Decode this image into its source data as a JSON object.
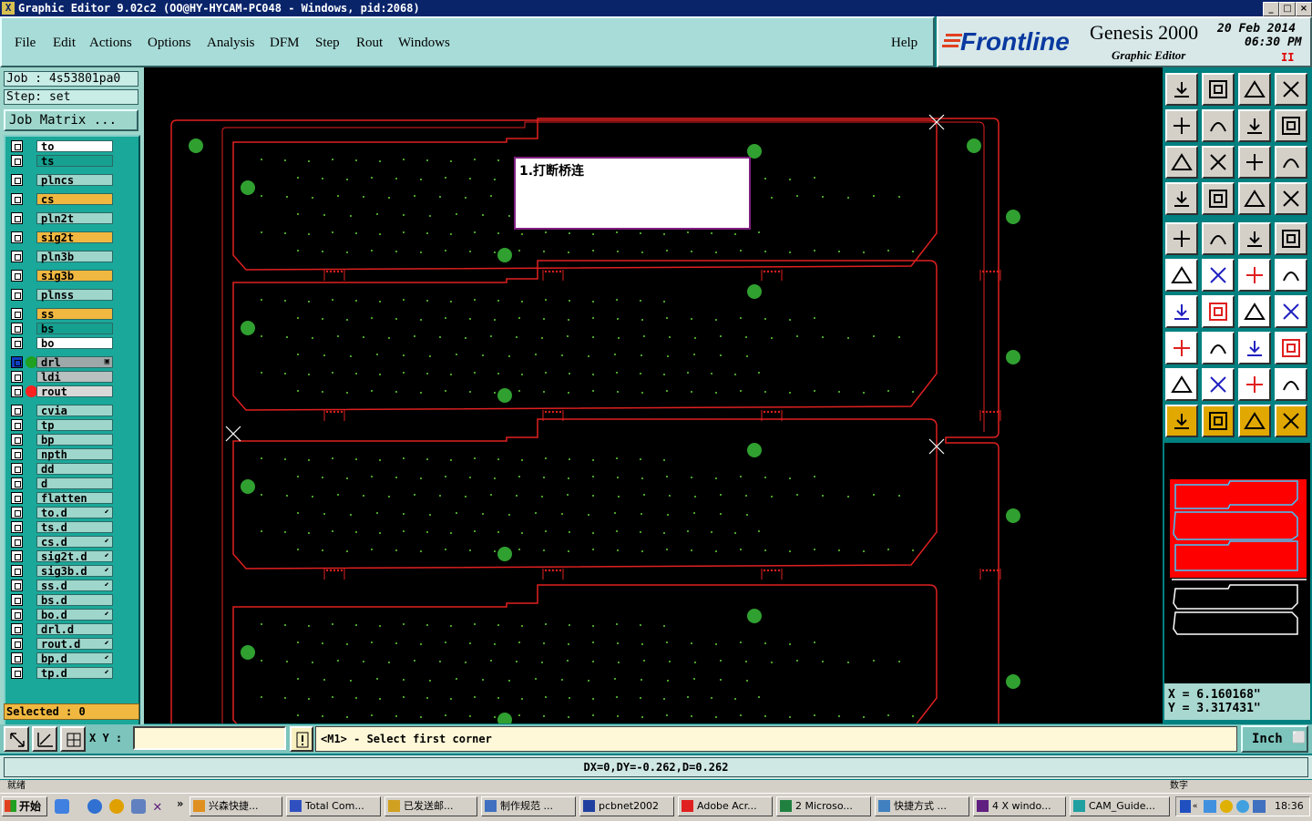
{
  "window": {
    "title": "Graphic Editor 9.02c2  (OO@HY-HYCAM-PC048 - Windows, pid:2068)",
    "icon": "X"
  },
  "menu": [
    "File",
    "Edit",
    "Actions",
    "Options",
    "Analysis",
    "DFM",
    "Step",
    "Rout",
    "Windows"
  ],
  "help": "Help",
  "brand": {
    "logo": "Frontline",
    "product": "Genesis 2000",
    "subtitle": "Graphic Editor",
    "date": "20 Feb 2014",
    "time": "06:30 PM",
    "pause": "II"
  },
  "job": {
    "label": "Job : 4s53801pa0",
    "step": "Step:  set",
    "matrix_button": "Job Matrix ..."
  },
  "layers": [
    {
      "name": "to",
      "bg": "#ffffff"
    },
    {
      "name": "ts",
      "bg": "#16a090"
    },
    {
      "name": "plncs",
      "bg": "#9ed6cc"
    },
    {
      "name": "cs",
      "bg": "#f0b840"
    },
    {
      "name": "pln2t",
      "bg": "#9ed6cc"
    },
    {
      "name": "sig2t",
      "bg": "#f0b840"
    },
    {
      "name": "pln3b",
      "bg": "#9ed6cc"
    },
    {
      "name": "sig3b",
      "bg": "#f0b840"
    },
    {
      "name": "plnss",
      "bg": "#9ed6cc"
    },
    {
      "name": "ss",
      "bg": "#f0b840"
    },
    {
      "name": "bs",
      "bg": "#16a090"
    },
    {
      "name": "bo",
      "bg": "#ffffff"
    },
    {
      "name": "drl",
      "bg": "#9ea8a8",
      "dot": "#20a020",
      "mark": "▣",
      "selected": true
    },
    {
      "name": "ldi",
      "bg": "#b8c0c0"
    },
    {
      "name": "rout",
      "bg": "#d8d8d8",
      "dot": "#ff2020"
    },
    {
      "name": "cvia",
      "bg": "#9ed6cc"
    },
    {
      "name": "tp",
      "bg": "#9ed6cc"
    },
    {
      "name": "bp",
      "bg": "#9ed6cc"
    },
    {
      "name": "npth",
      "bg": "#9ed6cc"
    },
    {
      "name": "dd",
      "bg": "#9ed6cc"
    },
    {
      "name": "d",
      "bg": "#9ed6cc"
    },
    {
      "name": "flatten",
      "bg": "#9ed6cc"
    },
    {
      "name": "to.d",
      "bg": "#9ed6cc",
      "mark": "⬋"
    },
    {
      "name": "ts.d",
      "bg": "#9ed6cc"
    },
    {
      "name": "cs.d",
      "bg": "#9ed6cc",
      "mark": "⬋"
    },
    {
      "name": "sig2t.d",
      "bg": "#9ed6cc",
      "mark": "⬋"
    },
    {
      "name": "sig3b.d",
      "bg": "#9ed6cc",
      "mark": "⬋"
    },
    {
      "name": "ss.d",
      "bg": "#9ed6cc",
      "mark": "⬋"
    },
    {
      "name": "bs.d",
      "bg": "#9ed6cc"
    },
    {
      "name": "bo.d",
      "bg": "#9ed6cc",
      "mark": "⬋"
    },
    {
      "name": "drl.d",
      "bg": "#9ed6cc"
    },
    {
      "name": "rout.d",
      "bg": "#9ed6cc",
      "mark": "⬋"
    },
    {
      "name": "bp.d",
      "bg": "#9ed6cc",
      "mark": "⬋"
    },
    {
      "name": "tp.d",
      "bg": "#9ed6cc",
      "mark": "⬋"
    }
  ],
  "selected_status": "Selected : 0",
  "annotation": "1.打断桥连",
  "coords": {
    "x": "X  =  6.160168\"",
    "y": "Y  =  3.317431\""
  },
  "command": {
    "xy_label": "X Y :",
    "xy_value": "",
    "prompt": "<M1> - Select first corner",
    "units": "Inch"
  },
  "measure": "DX=0,DY=-0.262,D=0.262",
  "status_left": "就绪",
  "status_right": "数字",
  "taskbar": {
    "start": "开始",
    "tasks": [
      "兴森快捷...",
      "Total Com...",
      "已发送邮...",
      "制作规范 ...",
      "pcbnet2002",
      "Adobe Acr...",
      "2 Microso...",
      "快捷方式 ...",
      "4 X windo...",
      "CAM_Guide..."
    ],
    "clock": "18:36"
  }
}
